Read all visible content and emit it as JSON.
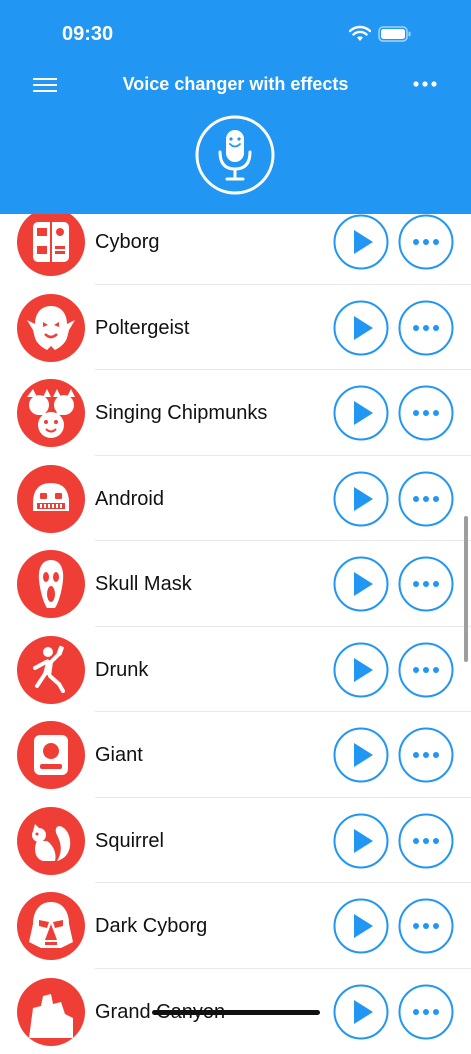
{
  "status": {
    "time": "09:30"
  },
  "header": {
    "title": "Voice changer with effects"
  },
  "colors": {
    "accent": "#2196f3",
    "avatar": "#ef3e36"
  },
  "effects": [
    {
      "name": "Cyborg",
      "icon": "cyborg-icon"
    },
    {
      "name": "Poltergeist",
      "icon": "ghost-icon"
    },
    {
      "name": "Singing Chipmunks",
      "icon": "chipmunks-icon"
    },
    {
      "name": "Android",
      "icon": "android-icon"
    },
    {
      "name": "Skull Mask",
      "icon": "scream-mask-icon"
    },
    {
      "name": "Drunk",
      "icon": "drunk-person-icon"
    },
    {
      "name": "Giant",
      "icon": "giant-icon"
    },
    {
      "name": "Squirrel",
      "icon": "squirrel-icon"
    },
    {
      "name": "Dark Cyborg",
      "icon": "dark-cyborg-icon"
    },
    {
      "name": "Grand Canyon",
      "icon": "canyon-icon"
    }
  ]
}
